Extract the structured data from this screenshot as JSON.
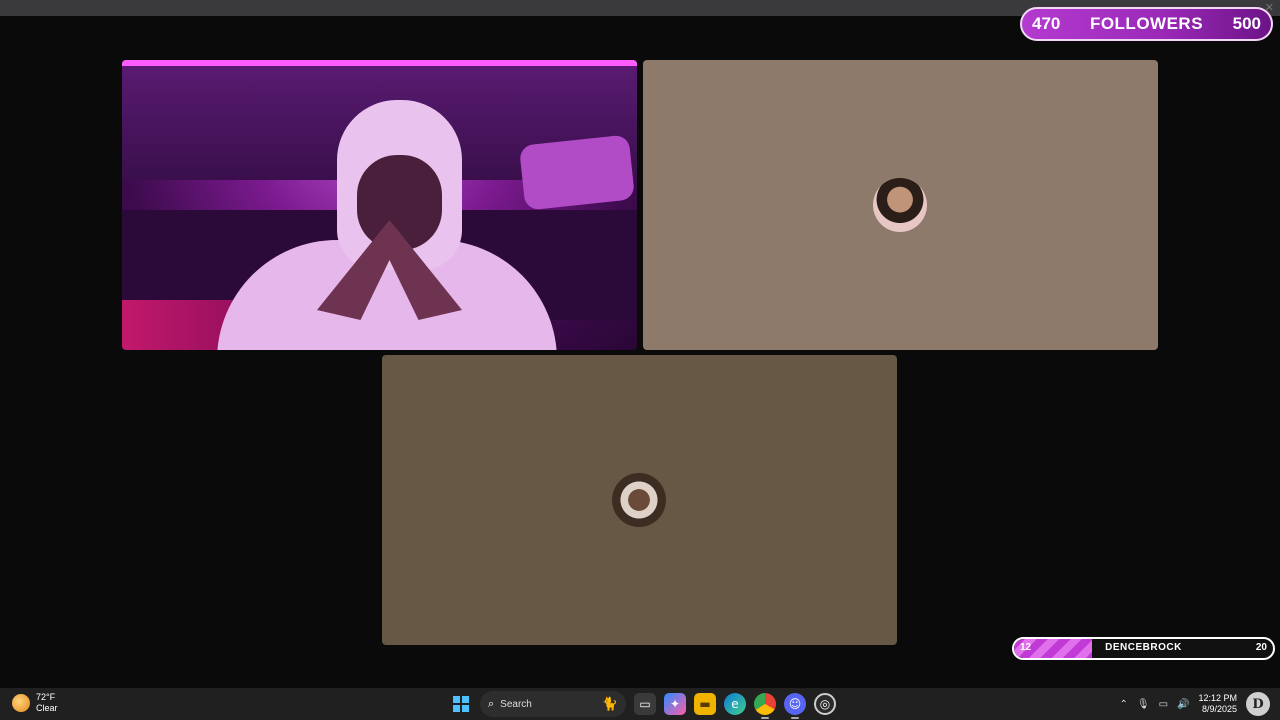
{
  "followers_goal": {
    "current": "470",
    "label": "FOLLOWERS",
    "target": "500"
  },
  "sub_goal": {
    "start": "12",
    "name": "DENCEBROCK",
    "end": "20",
    "progress": 0.3
  },
  "tiles": [
    {
      "id": "webcam"
    },
    {
      "id": "user2"
    },
    {
      "id": "user3"
    }
  ],
  "taskbar": {
    "weather_temp": "72°F",
    "weather_desc": "Clear",
    "search_placeholder": "Search",
    "clock_time": "12:12 PM",
    "clock_date": "8/9/2025",
    "apps": [
      "file-explorer",
      "copilot",
      "folder",
      "edge",
      "chrome",
      "discord",
      "obs"
    ]
  },
  "colors": {
    "accent": "#b43ad0",
    "tile_user2": "#8e7a6b",
    "tile_user3": "#665845"
  }
}
